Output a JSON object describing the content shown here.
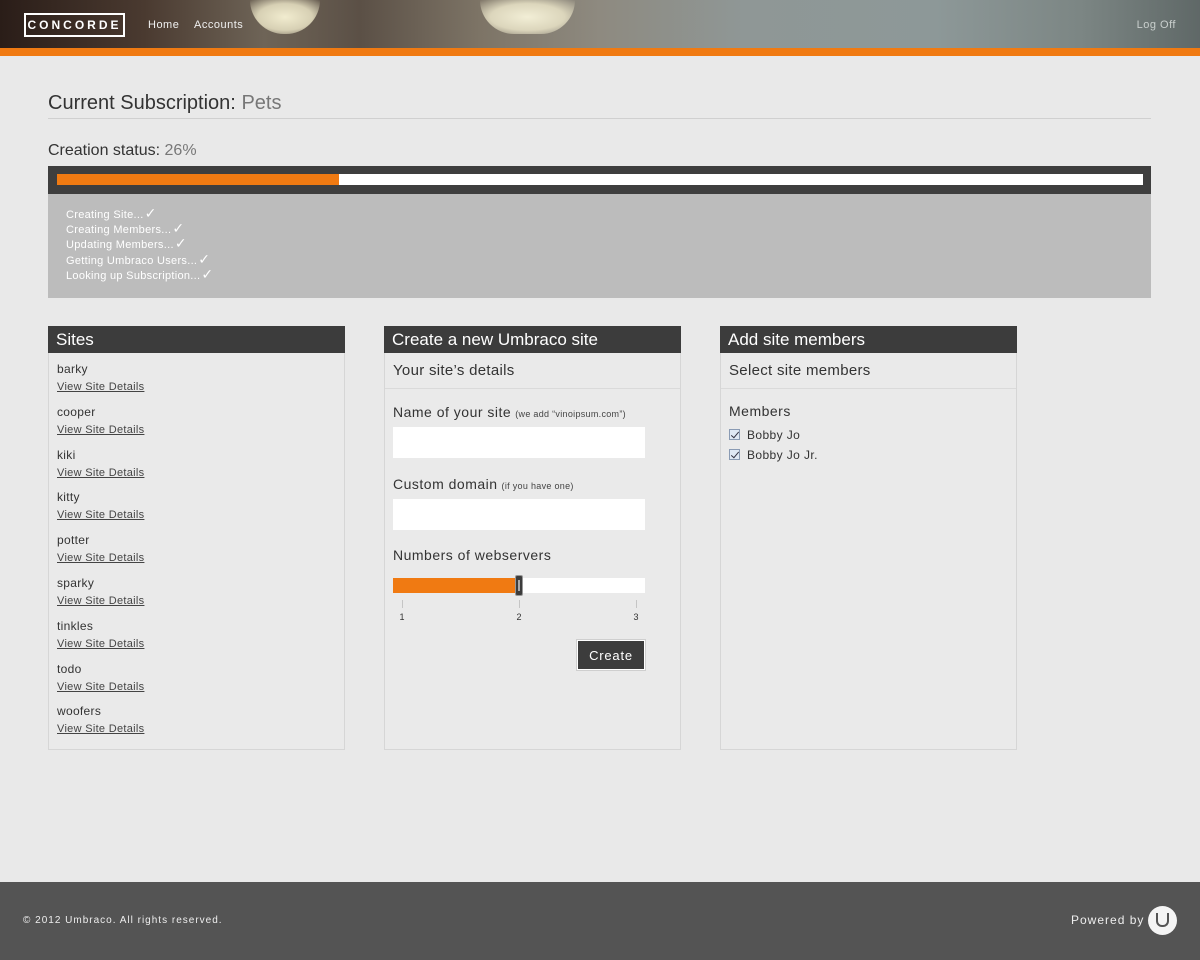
{
  "header": {
    "logo": "CONCORDE",
    "nav": {
      "home": "Home",
      "accounts": "Accounts"
    },
    "logoff": "Log Off"
  },
  "subscription": {
    "label": "Current Subscription:",
    "value": "Pets"
  },
  "creation_status": {
    "label": "Creation status:",
    "value": "26%",
    "progress": 0.26,
    "steps": [
      {
        "text": "Creating Site...",
        "check": "✓"
      },
      {
        "text": "Creating Members...",
        "check": "✓"
      },
      {
        "text": "Updating Members...",
        "check": "✓"
      },
      {
        "text": "Getting Umbraco Users...",
        "check": "✓"
      },
      {
        "text": "Looking up Subscription...",
        "check": "✓"
      }
    ]
  },
  "sites_panel": {
    "title": "Sites",
    "link_label": "View Site Details",
    "sites": [
      "barky",
      "cooper",
      "kiki",
      "kitty",
      "potter",
      "sparky",
      "tinkles",
      "todo",
      "woofers"
    ]
  },
  "create_panel": {
    "title": "Create a new Umbraco site",
    "section": "Your site’s details",
    "name_label": "Name of your site",
    "name_hint": "(we add “vinoipsum.com”)",
    "name_value": "",
    "domain_label": "Custom domain",
    "domain_hint": "(if you have one)",
    "domain_value": "",
    "servers_label": "Numbers of webservers",
    "slider": {
      "min": 1,
      "max": 3,
      "value": 2,
      "ticks": [
        "1",
        "2",
        "3"
      ]
    },
    "create_button": "Create"
  },
  "members_panel": {
    "title": "Add site members",
    "section": "Select site members",
    "members_label": "Members",
    "members": [
      {
        "name": "Bobby Jo",
        "checked": true
      },
      {
        "name": "Bobby Jo Jr.",
        "checked": true
      }
    ]
  },
  "footer": {
    "copyright": "© 2012 Umbraco. All rights reserved.",
    "powered_by": "Powered by"
  },
  "colors": {
    "accent": "#f07a12",
    "dark": "#3c3c3c",
    "footer": "#545454"
  }
}
